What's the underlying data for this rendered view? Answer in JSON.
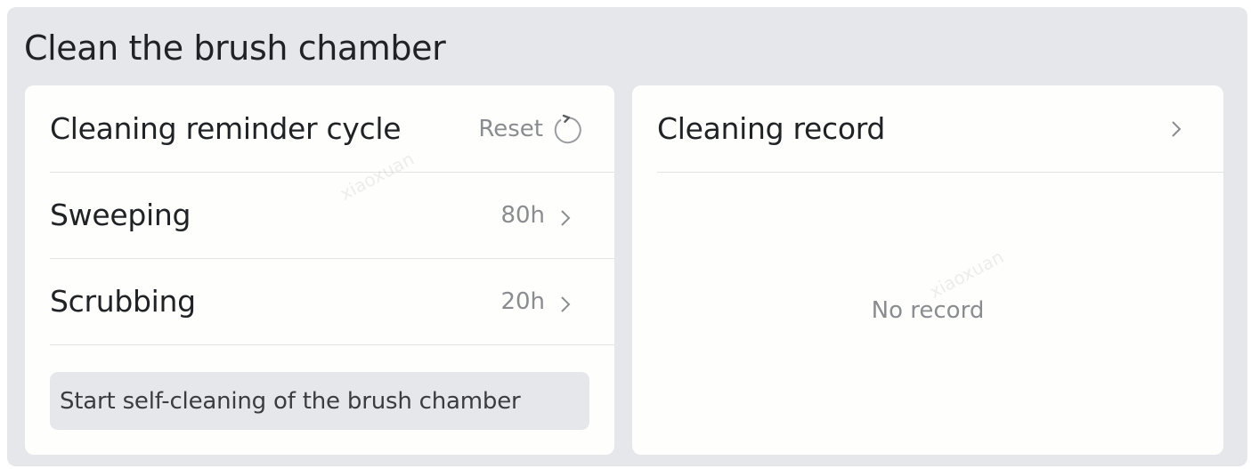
{
  "page": {
    "title": "Clean the brush chamber"
  },
  "reminder": {
    "title": "Cleaning reminder cycle",
    "reset_label": "Reset",
    "items": [
      {
        "label": "Sweeping",
        "value": "80h"
      },
      {
        "label": "Scrubbing",
        "value": "20h"
      }
    ],
    "start_button": "Start self-cleaning of the brush chamber"
  },
  "record": {
    "title": "Cleaning record",
    "empty_text": "No record"
  },
  "watermark": "xiaoxuan",
  "icons": {
    "reset": "refresh-icon",
    "chevron": "chevron-right-icon"
  },
  "colors": {
    "background": "#e5e7ea",
    "card": "#fefefc",
    "primary_text": "#202225",
    "secondary_text": "#8a8c90",
    "button_bg": "#e6e7ea"
  }
}
